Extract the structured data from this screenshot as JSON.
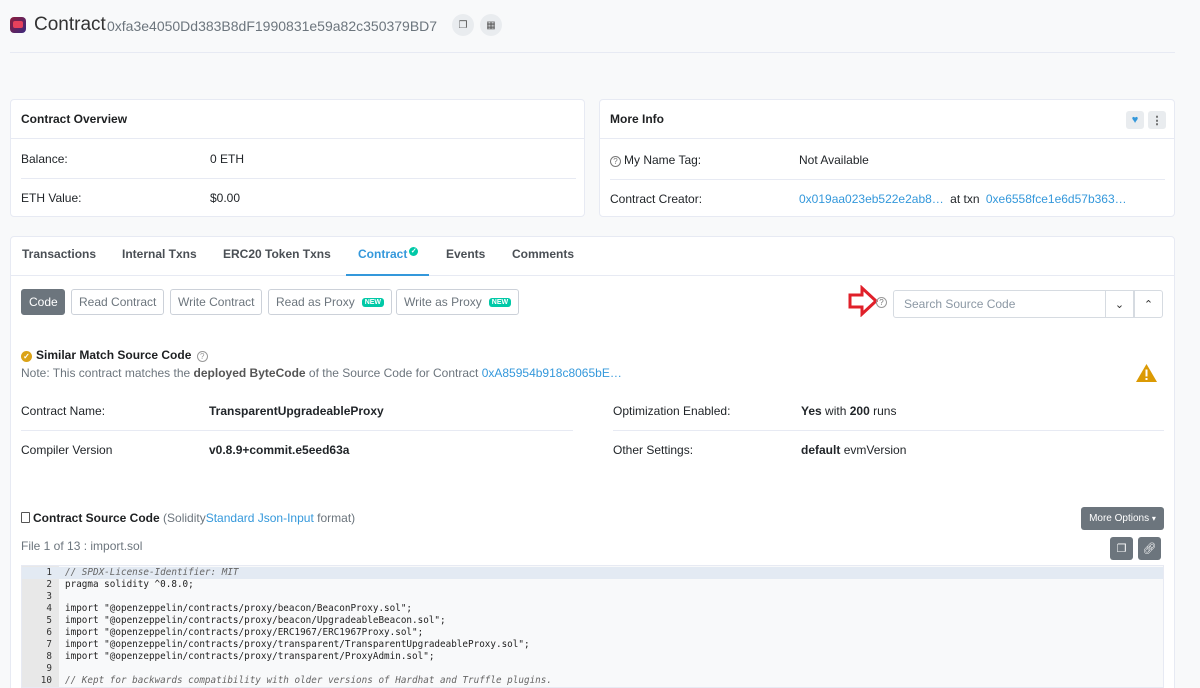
{
  "header": {
    "title": "Contract",
    "address": "0xfa3e4050Dd383B8dF1990831e59a82c350379BD7",
    "copy_icon": "copy-icon",
    "qr_icon": "qr-code-icon"
  },
  "overview": {
    "title": "Contract Overview",
    "balance_label": "Balance:",
    "balance_value": "0 ETH",
    "eth_value_label": "ETH Value:",
    "eth_value": "$0.00"
  },
  "more_info": {
    "title": "More Info",
    "name_tag_label": "My Name Tag:",
    "name_tag_value": "Not Available",
    "creator_label": "Contract Creator:",
    "creator_address": "0x019aa023eb522e2ab8…",
    "at_txn": "at txn",
    "creator_txn": "0xe6558fce1e6d57b363…"
  },
  "tabs": [
    {
      "label": "Transactions"
    },
    {
      "label": "Internal Txns"
    },
    {
      "label": "ERC20 Token Txns"
    },
    {
      "label": "Contract"
    },
    {
      "label": "Events"
    },
    {
      "label": "Comments"
    }
  ],
  "subtabs": [
    {
      "label": "Code"
    },
    {
      "label": "Read Contract"
    },
    {
      "label": "Write Contract"
    },
    {
      "label": "Read as Proxy",
      "badge": "NEW"
    },
    {
      "label": "Write as Proxy",
      "badge": "NEW"
    }
  ],
  "search": {
    "placeholder": "Search Source Code"
  },
  "similar_match": {
    "title": "Similar Match Source Code",
    "note_prefix": "Note: This contract matches the",
    "note_bold": "deployed ByteCode",
    "note_middle": "of the Source Code for Contract",
    "note_link": "0xA85954b918c8065bE…"
  },
  "contract_info": {
    "name_label": "Contract Name:",
    "name_value": "TransparentUpgradeableProxy",
    "compiler_label": "Compiler Version",
    "compiler_value": "v0.8.9+commit.e5eed63a",
    "optimization_label": "Optimization Enabled:",
    "optimization_yes": "Yes",
    "optimization_with": "with",
    "optimization_runs": "200",
    "optimization_runs_suffix": "runs",
    "other_label": "Other Settings:",
    "other_bold": "default",
    "other_rest": "evmVersion"
  },
  "source": {
    "title": "Contract Source Code",
    "format_prefix": "(Solidity",
    "format_link": "Standard Json-Input",
    "format_suffix": "format)",
    "file_label": "File 1 of 13 : import.sol",
    "more_options": "More Options"
  },
  "code_lines": [
    {
      "n": "1",
      "text": "// SPDX-License-Identifier: MIT",
      "comment": true
    },
    {
      "n": "2",
      "text": "pragma solidity ^0.8.0;"
    },
    {
      "n": "3",
      "text": ""
    },
    {
      "n": "4",
      "text": "import \"@openzeppelin/contracts/proxy/beacon/BeaconProxy.sol\";"
    },
    {
      "n": "5",
      "text": "import \"@openzeppelin/contracts/proxy/beacon/UpgradeableBeacon.sol\";"
    },
    {
      "n": "6",
      "text": "import \"@openzeppelin/contracts/proxy/ERC1967/ERC1967Proxy.sol\";"
    },
    {
      "n": "7",
      "text": "import \"@openzeppelin/contracts/proxy/transparent/TransparentUpgradeableProxy.sol\";"
    },
    {
      "n": "8",
      "text": "import \"@openzeppelin/contracts/proxy/transparent/ProxyAdmin.sol\";"
    },
    {
      "n": "9",
      "text": ""
    },
    {
      "n": "10",
      "text": "// Kept for backwards compatibility with older versions of Hardhat and Truffle plugins.",
      "comment": true
    }
  ]
}
